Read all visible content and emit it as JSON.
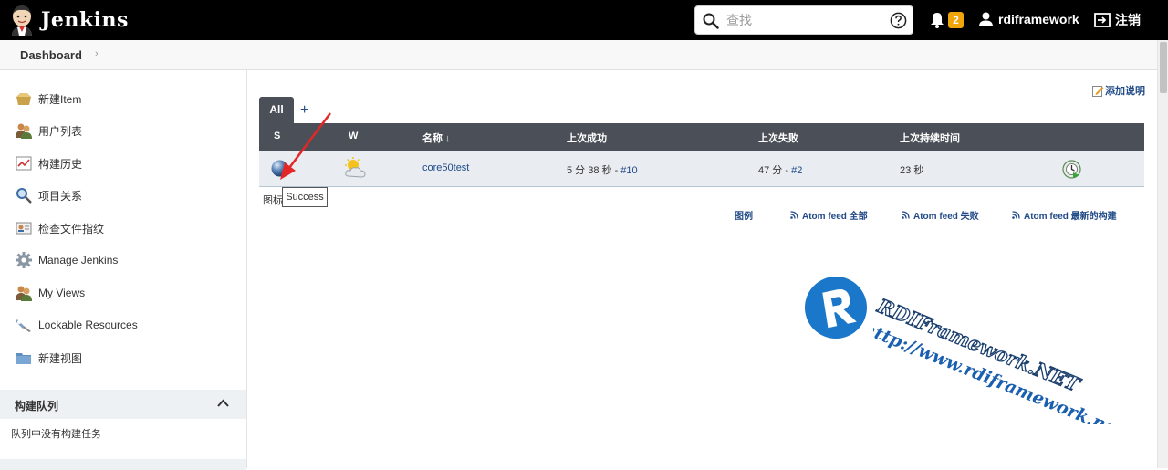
{
  "header": {
    "title": "Jenkins",
    "search_placeholder": "查找",
    "notification_count": "2",
    "username": "rdiframework",
    "logout_label": "注销"
  },
  "breadcrumb": {
    "root": "Dashboard",
    "arrow": "›"
  },
  "sidebar": {
    "items": [
      {
        "label": "新建Item",
        "icon": "new-item-icon"
      },
      {
        "label": "用户列表",
        "icon": "users-icon"
      },
      {
        "label": "构建历史",
        "icon": "history-icon"
      },
      {
        "label": "项目关系",
        "icon": "search-icon"
      },
      {
        "label": "检查文件指纹",
        "icon": "fingerprint-icon"
      },
      {
        "label": "Manage Jenkins",
        "icon": "gear-icon"
      },
      {
        "label": "My Views",
        "icon": "users-icon"
      },
      {
        "label": "Lockable Resources",
        "icon": "lock-icon"
      },
      {
        "label": "新建视图",
        "icon": "folder-icon"
      }
    ],
    "queue": {
      "title": "构建队列",
      "empty_text": "队列中没有构建任务"
    }
  },
  "main": {
    "add_description": "添加说明",
    "tabs": [
      {
        "label": "All"
      }
    ],
    "tab_add": "+",
    "table": {
      "headers": {
        "s": "S",
        "w": "W",
        "name": "名称 ↓",
        "last_success": "上次成功",
        "last_failure": "上次失败",
        "last_duration": "上次持续时间"
      },
      "rows": [
        {
          "name": "core50test",
          "last_success_time": "5 分 38 秒 - ",
          "last_success_link": "#10",
          "last_failure_time": "47 分 - ",
          "last_failure_link": "#2",
          "last_duration": "23 秒"
        }
      ]
    },
    "icon_legend_label": "图标",
    "tooltip": "Success",
    "feeds": {
      "legend": "图例",
      "all": "Atom feed 全部",
      "failed": "Atom feed 失败",
      "latest": "Atom feed 最新的构建"
    }
  },
  "watermark": {
    "brand": "RDIFramework.NET",
    "url": "http://www.rdiframework.net"
  },
  "colors": {
    "header_bg": "#000000",
    "table_head_bg": "#4b5058",
    "row_bg": "#e9edf2",
    "link": "#204a87",
    "badge": "#f0a50a",
    "arrow": "#e32727",
    "watermark": "#1a77c9"
  }
}
